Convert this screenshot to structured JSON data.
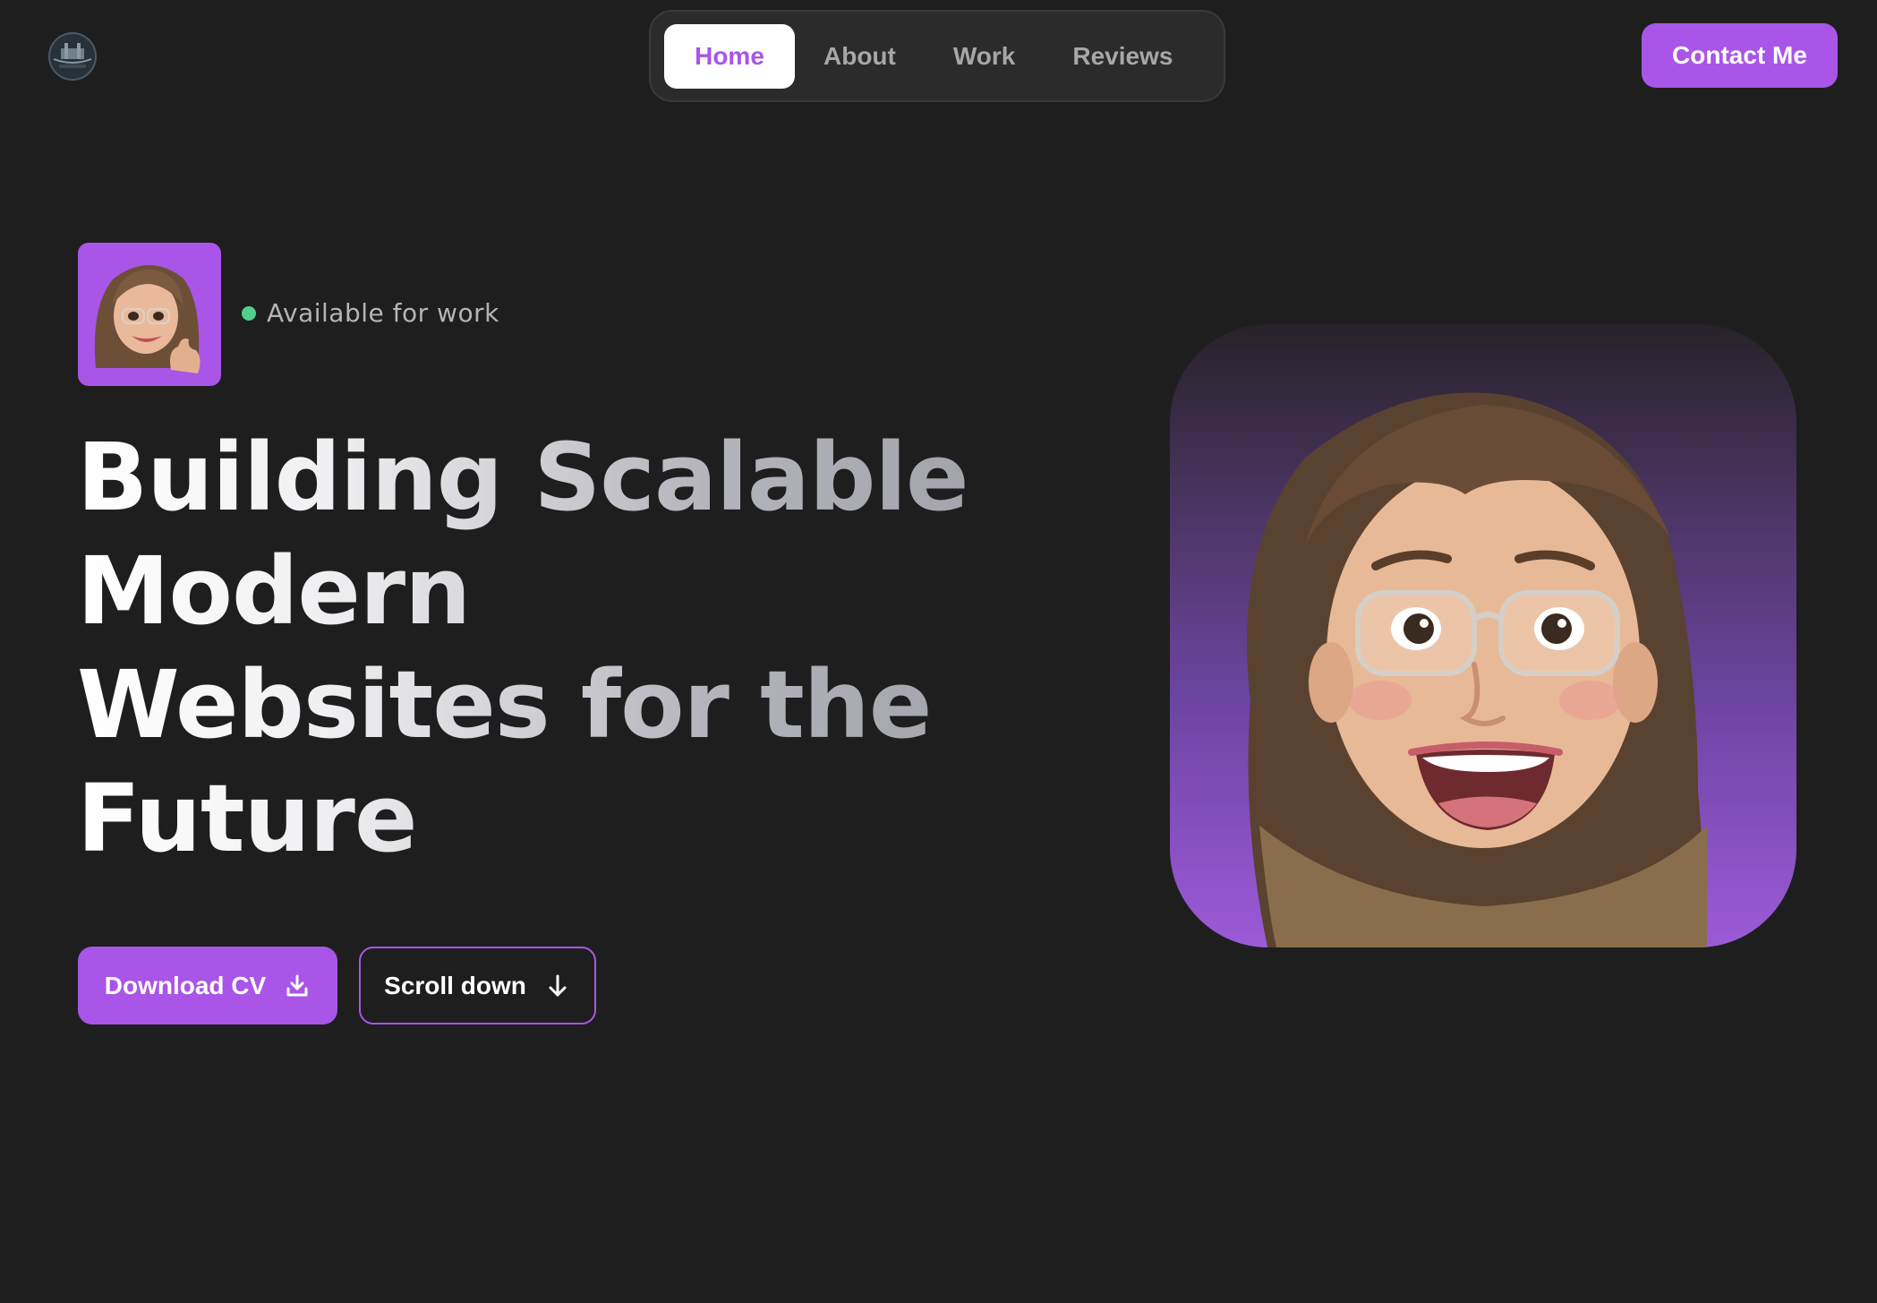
{
  "header": {
    "logo_name": "logo",
    "nav": [
      {
        "label": "Home",
        "active": true
      },
      {
        "label": "About",
        "active": false
      },
      {
        "label": "Work",
        "active": false
      },
      {
        "label": "Reviews",
        "active": false
      }
    ],
    "contact_label": "Contact Me"
  },
  "hero": {
    "status_text": "Available for work",
    "status_color": "#4fd18b",
    "headline_lines": [
      "Building Scalable",
      "Modern",
      "Websites for the",
      "Future"
    ],
    "download_label": "Download CV",
    "scroll_label": "Scroll down"
  },
  "colors": {
    "background": "#1e1e1f",
    "accent": "#a855e8",
    "nav_bg": "#2b2b2c"
  },
  "icons": {
    "download": "download-icon",
    "scroll": "arrow-down-icon"
  }
}
